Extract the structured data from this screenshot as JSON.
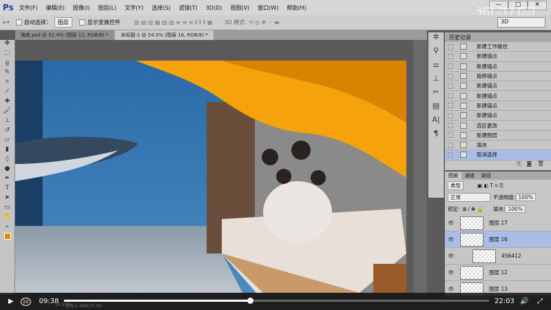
{
  "app": {
    "logo": "Ps",
    "watermark": "视汉园"
  },
  "menu": [
    "文件(F)",
    "编辑(E)",
    "图像(I)",
    "图层(L)",
    "文字(Y)",
    "选择(S)",
    "滤镜(T)",
    "3D(D)",
    "视图(V)",
    "窗口(W)",
    "帮助(H)"
  ],
  "window_buttons": [
    "—",
    "□",
    "✕"
  ],
  "options": {
    "auto_select_label": "自动选择：",
    "auto_select_value": "图层",
    "show_transform": "显示变换控件",
    "mode_3d_label": "3D 模式:",
    "workspace": "3D"
  },
  "tabs": [
    {
      "label": "海底.psd @ 52.4% (图层 12, RGB/8) *",
      "active": false
    },
    {
      "label": "未标题-1 @ 54.5% (图层 16, RGB/8) *",
      "active": true
    }
  ],
  "history": {
    "title": "历史记录",
    "items": [
      "新建工作路径",
      "新建锚点",
      "新建锚点",
      "拖移锚点",
      "新建锚点",
      "新建锚点",
      "新建锚点",
      "新建锚点",
      "选区更改",
      "新建图层",
      "填充",
      "取消选择"
    ],
    "selected": 11
  },
  "layers": {
    "tabs": [
      "图层",
      "通道",
      "路径"
    ],
    "filter": "类型",
    "blend_mode": "正常",
    "opacity_label": "不透明度:",
    "opacity": "100%",
    "lock_label": "锁定:",
    "fill_label": "填充:",
    "fill": "100%",
    "items": [
      {
        "name": "图层 17",
        "selected": false
      },
      {
        "name": "图层 16",
        "selected": true
      },
      {
        "name": "456412",
        "selected": false,
        "clipped": true
      },
      {
        "name": "图层 12",
        "selected": false
      },
      {
        "name": "图层 13",
        "selected": false
      }
    ]
  },
  "status": {
    "zoom": "54.51%",
    "doc": "文档:5.49M/73.0M"
  },
  "player": {
    "current_time": "09:38",
    "total_time": "22:03",
    "progress": 0.437,
    "skip_label": "10"
  }
}
